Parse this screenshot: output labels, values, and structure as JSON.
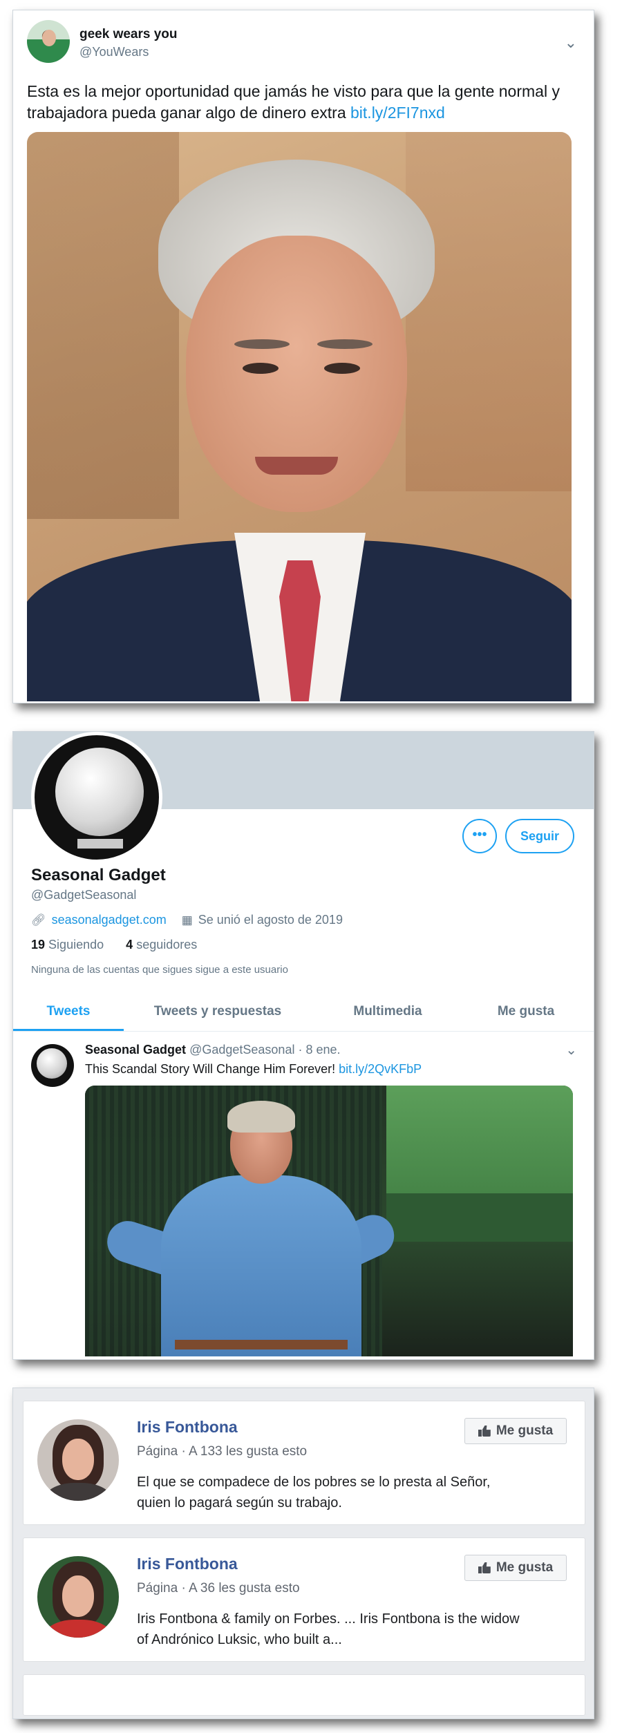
{
  "tweet1": {
    "name": "geek wears you",
    "handle": "@YouWears",
    "text": "Esta es la mejor oportunidad que jamás he visto para que la gente normal y trabajadora pueda ganar algo de dinero extra ",
    "link": "bit.ly/2FI7nxd"
  },
  "profile": {
    "name": "Seasonal Gadget",
    "handle": "@GadgetSeasonal",
    "more_label": "•••",
    "follow_label": "Seguir",
    "website": "seasonalgadget.com",
    "joined": "Se unió el agosto de 2019",
    "following_count": "19",
    "following_label": "Siguiendo",
    "followers_count": "4",
    "followers_label": "seguidores",
    "note": "Ninguna de las cuentas que sigues sigue a este usuario",
    "tabs": [
      {
        "label": "Tweets"
      },
      {
        "label": "Tweets y respuestas"
      },
      {
        "label": "Multimedia"
      },
      {
        "label": "Me gusta"
      }
    ],
    "tweet": {
      "name": "Seasonal Gadget",
      "handle": "@GadgetSeasonal",
      "date": "· 8 ene.",
      "text": "This Scandal Story Will Change Him Forever! ",
      "link": "bit.ly/2QvKFbP"
    }
  },
  "fb": [
    {
      "name": "Iris Fontbona",
      "meta": "Página · A 133 les gusta esto",
      "text": "El que se compadece de los pobres se lo presta al Señor, quien lo pagará según su trabajo.",
      "like_label": "Me gusta"
    },
    {
      "name": "Iris Fontbona",
      "meta": "Página · A 36 les gusta esto",
      "text": "Iris Fontbona & family on Forbes. ... Iris Fontbona is the widow of Andrónico Luksic, who built a...",
      "like_label": "Me gusta"
    }
  ]
}
